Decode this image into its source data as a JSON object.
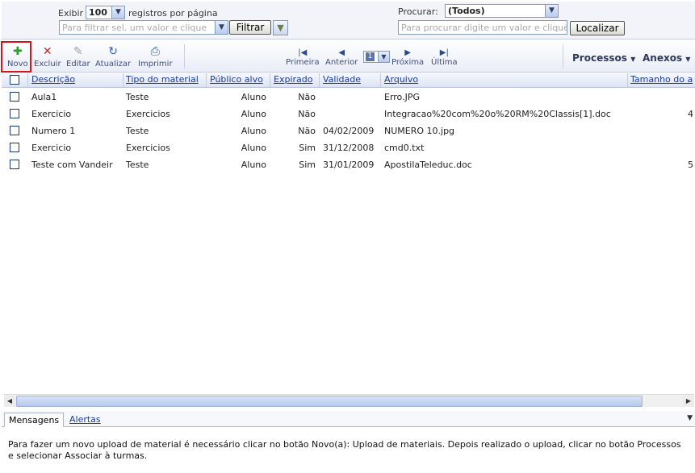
{
  "filter": {
    "show_label": "Exibir",
    "per_page_value": "100",
    "per_page_suffix": "registros por página",
    "filter_placeholder": "Para filtrar sel. um valor e clique",
    "filter_button": "Filtrar",
    "search_label": "Procurar:",
    "search_scope": "(Todos)",
    "search_placeholder": "Para procurar digite um valor e clique",
    "search_button": "Localizar"
  },
  "toolbar": {
    "new": "Novo",
    "delete": "Excluir",
    "edit": "Editar",
    "refresh": "Atualizar",
    "print": "Imprimir",
    "first": "Primeira",
    "previous": "Anterior",
    "page": "1",
    "next": "Próxima",
    "last": "Última",
    "processes_menu": "Processos",
    "attachments_menu": "Anexos"
  },
  "table": {
    "columns": [
      "Descrição",
      "Tipo do material",
      "Público alvo",
      "Expirado",
      "Validade",
      "Arquivo",
      "Tamanho do a"
    ],
    "rows": [
      {
        "descricao": "Aula1",
        "tipo": "Teste",
        "publico": "Aluno",
        "expirado": "Não",
        "validade": "",
        "arquivo": "Erro.JPG",
        "tamanho": ""
      },
      {
        "descricao": "Exercicio",
        "tipo": "Exercicios",
        "publico": "Aluno",
        "expirado": "Não",
        "validade": "",
        "arquivo": "Integracao%20com%20o%20RM%20Classis[1].doc",
        "tamanho": "4"
      },
      {
        "descricao": "Numero 1",
        "tipo": "Teste",
        "publico": "Aluno",
        "expirado": "Não",
        "validade": "04/02/2009",
        "arquivo": "NUMERO 10.jpg",
        "tamanho": ""
      },
      {
        "descricao": "Exercicio",
        "tipo": "Exercicios",
        "publico": "Aluno",
        "expirado": "Sim",
        "validade": "31/12/2008",
        "arquivo": "cmd0.txt",
        "tamanho": ""
      },
      {
        "descricao": "Teste com Vandeir",
        "tipo": "Teste",
        "publico": "Aluno",
        "expirado": "Sim",
        "validade": "31/01/2009",
        "arquivo": "ApostilaTeleduc.doc",
        "tamanho": "5"
      }
    ]
  },
  "bottom": {
    "tab_messages": "Mensagens",
    "tab_alerts": "Alertas",
    "message": "Para fazer um novo upload de material é necessário clicar no botão Novo(a): Upload de materiais. Depois realizado o upload, clicar no botão Processos e selecionar Associar à turmas."
  },
  "icons": {
    "new": "plus-document-icon",
    "delete": "red-x-icon",
    "edit": "pencil-icon",
    "refresh": "refresh-arrows-icon",
    "print": "printer-icon",
    "funnel": "funnel-icon"
  },
  "colors": {
    "highlight": "#d7141c",
    "link": "#1a3a9c",
    "header_bg": "#dde4f2"
  }
}
